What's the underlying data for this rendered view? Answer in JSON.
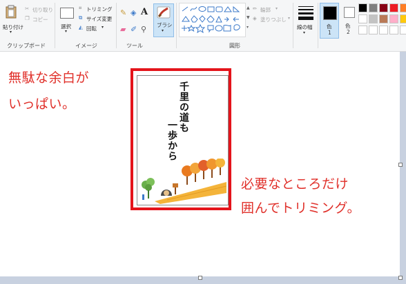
{
  "ribbon": {
    "clipboard": {
      "paste_label": "貼り付け",
      "cut_label": "切り取り",
      "copy_label": "コピー",
      "group_label": "クリップボード"
    },
    "image": {
      "select_label": "選択",
      "crop_label": "トリミング",
      "resize_label": "サイズ変更",
      "rotate_label": "回転",
      "group_label": "イメージ"
    },
    "tools": {
      "group_label": "ツール"
    },
    "brushes": {
      "label": "ブラシ"
    },
    "shapes": {
      "outline_label": "輪郭",
      "fill_label": "塗りつぶし",
      "group_label": "図形"
    },
    "size": {
      "label": "線の幅"
    },
    "colors": {
      "color1_label": "色",
      "color1_num": "1",
      "color2_label": "色",
      "color2_num": "2",
      "color1": "#000000",
      "color2": "#ffffff",
      "palette_row1": [
        "#000000",
        "#7f7f7f",
        "#880015",
        "#ed1c24",
        "#ff7f27"
      ],
      "palette_row2": [
        "#ffffff",
        "#c3c3c3",
        "#b97a57",
        "#ffaec9",
        "#ffc90e"
      ],
      "palette_row3": [
        "#ffffff",
        "#ffffff",
        "#ffffff",
        "#ffffff",
        "#ffffff"
      ]
    }
  },
  "annotations": {
    "left_line1": "無駄な余白が",
    "left_line2": "いっぱい。",
    "right_line1": "必要なところだけ",
    "right_line2": "囲んでトリミング。"
  },
  "card": {
    "col1": "千里の道も",
    "col2": "一歩から"
  },
  "accent": "#e4141b"
}
